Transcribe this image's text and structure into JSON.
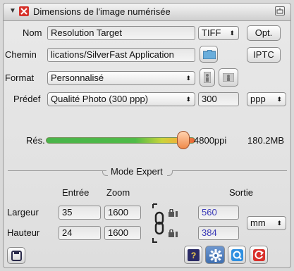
{
  "title": "Dimensions de l'image numérisée",
  "name": {
    "label": "Nom",
    "value": "Resolution Target",
    "format": "TIFF",
    "opt_button": "Opt."
  },
  "path": {
    "label": "Chemin",
    "value": "lications/SilverFast Application",
    "iptc_button": "IPTC"
  },
  "format": {
    "label": "Format",
    "value": "Personnalisé"
  },
  "preset": {
    "label": "Prédef",
    "value": "Qualité Photo (300 ppp)",
    "resolution": "300",
    "unit": "ppp"
  },
  "res": {
    "label": "Rés.",
    "value_text": "4800ppi",
    "size_text": "180.2MB",
    "slider_fraction": 0.92
  },
  "expert": {
    "label": "Mode Expert"
  },
  "columns": {
    "input": "Entrée",
    "zoom": "Zoom",
    "output": "Sortie"
  },
  "width": {
    "label": "Largeur",
    "input": "35",
    "zoom": "1600",
    "output": "560"
  },
  "height": {
    "label": "Hauteur",
    "input": "24",
    "zoom": "1600",
    "output": "384"
  },
  "output_unit": "mm",
  "colors": {
    "output_text": "#3a3ab8",
    "settings_icon": "#2f5f9e",
    "refresh_icon": "#d9302b"
  }
}
